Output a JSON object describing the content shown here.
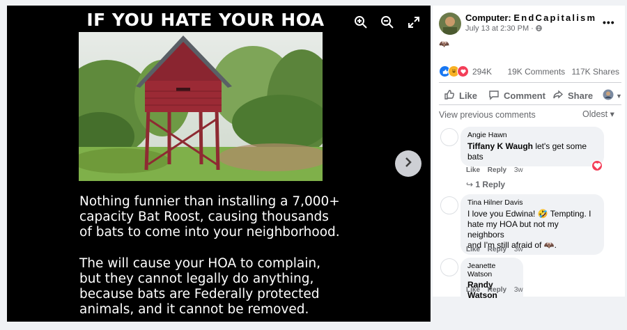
{
  "viewer": {
    "meme_title": "IF YOU HATE YOUR HOA",
    "paragraph1": "Nothing funnier than installing a 7,000+\ncapacity Bat Roost, causing thousands\nof bats to come into your neighborhood.",
    "paragraph2": "The will cause your HOA to complain,\nbut they cannot legally do anything,\nbecause bats are Federally protected\nanimals, and it cannot be removed.",
    "icons": [
      "zoom-in-icon",
      "zoom-out-icon",
      "fullscreen-icon",
      "chevron-right-icon"
    ]
  },
  "post": {
    "author_prefix": "Computer:",
    "author_spaced": "EndCapitalism",
    "timestamp": "July 13 at 2:30 PM ·",
    "text_emoji": "🦇",
    "reaction_count": "294K",
    "comments_count": "19K Comments",
    "shares_count": "117K Shares",
    "actions": {
      "like": "Like",
      "comment": "Comment",
      "share": "Share"
    },
    "view_previous": "View previous comments",
    "sort": "Oldest ▾"
  },
  "comments": [
    {
      "name": "Angie Hawn",
      "tag": "Tiffany K Waugh",
      "text": " let's get some bats",
      "like": "Like",
      "reply": "Reply",
      "age": "3w",
      "replies_link": "1 Reply"
    },
    {
      "name": "Tina Hilner Davis",
      "line1": "I love you Edwina! 🤣 Tempting. I",
      "line2": "hate my HOA but not my neighbors",
      "line3": "and I'm still afraid of 🦇.",
      "like": "Like",
      "reply": "Reply",
      "age": "3w"
    },
    {
      "name": "Jeanette Watson",
      "tag": "Randy Watson",
      "like": "Like",
      "reply": "Reply",
      "age": "3w"
    }
  ],
  "colors": {
    "accent": "#1877f2",
    "heart": "#f33e58",
    "barn": "#9b2a35"
  }
}
